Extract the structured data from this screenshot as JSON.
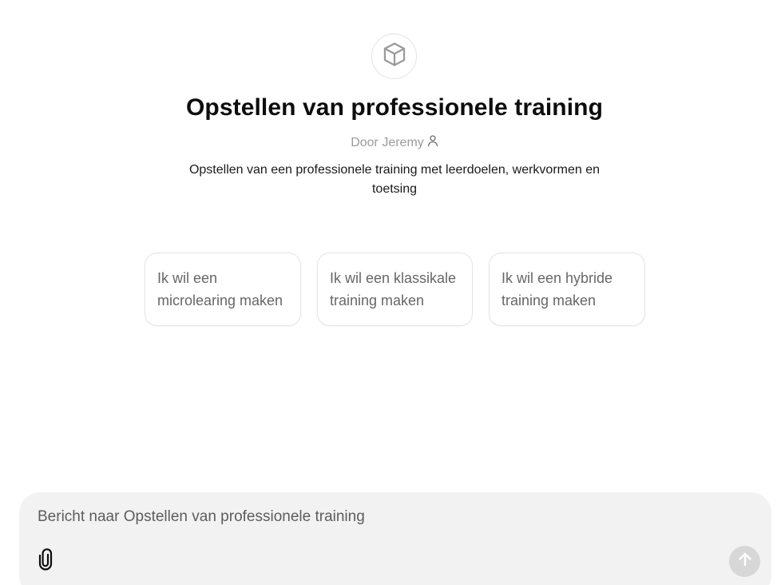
{
  "gpt": {
    "icon": "cube-icon",
    "title": "Opstellen van professionele training",
    "author": "Door Jeremy",
    "author_icon": "person-icon",
    "description": "Opstellen van een professionele training met leerdoelen, werkvormen en toetsing"
  },
  "conversation_starters": [
    {
      "label": "Ik wil een microlearing maken"
    },
    {
      "label": "Ik wil een klassikale training maken"
    },
    {
      "label": "Ik wil een hybride training maken"
    }
  ],
  "composer": {
    "placeholder": "Bericht naar Opstellen van professionele training",
    "value": "",
    "attach_icon": "paperclip-icon",
    "send_icon": "arrow-up-icon"
  },
  "colors": {
    "composer_background": "#f2f2f2",
    "send_button_disabled": "#d7d7d7",
    "muted_text": "#9b9b9b"
  }
}
